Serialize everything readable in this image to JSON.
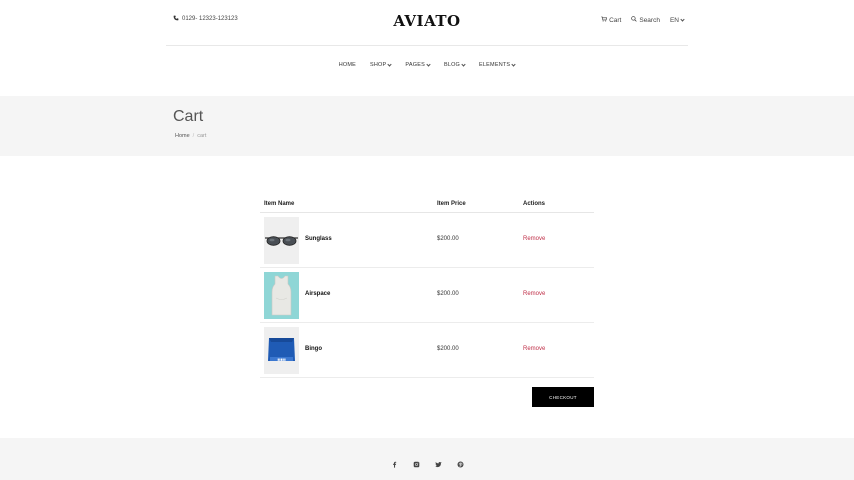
{
  "header": {
    "phone": "0129- 12323-123123",
    "logo": "AVIATO",
    "cart_label": "Cart",
    "search_label": "Search",
    "language": "EN"
  },
  "nav": {
    "items": [
      {
        "label": "HOME",
        "dropdown": false
      },
      {
        "label": "SHOP",
        "dropdown": true
      },
      {
        "label": "PAGES",
        "dropdown": true
      },
      {
        "label": "BLOG",
        "dropdown": true
      },
      {
        "label": "ELEMENTS",
        "dropdown": true
      }
    ]
  },
  "page": {
    "title": "Cart",
    "breadcrumb": [
      "Home",
      "cart"
    ],
    "breadcrumb_sep": "/"
  },
  "cart": {
    "columns": [
      "Item Name",
      "Item Price",
      "Actions"
    ],
    "rows": [
      {
        "name": "Sunglass",
        "price": "$200.00",
        "action": "Remove",
        "thumb": "sunglasses-image"
      },
      {
        "name": "Airspace",
        "price": "$200.00",
        "action": "Remove",
        "thumb": "tank-top-image"
      },
      {
        "name": "Bingo",
        "price": "$200.00",
        "action": "Remove",
        "thumb": "blue-shirt-image"
      }
    ],
    "checkout_label": "CHECKOUT"
  },
  "footer": {
    "socials": [
      "facebook-icon",
      "instagram-icon",
      "twitter-icon",
      "pinterest-icon"
    ]
  },
  "colors": {
    "remove": "#c0314a",
    "checkout_bg": "#000000",
    "band_bg": "#f5f5f5"
  }
}
